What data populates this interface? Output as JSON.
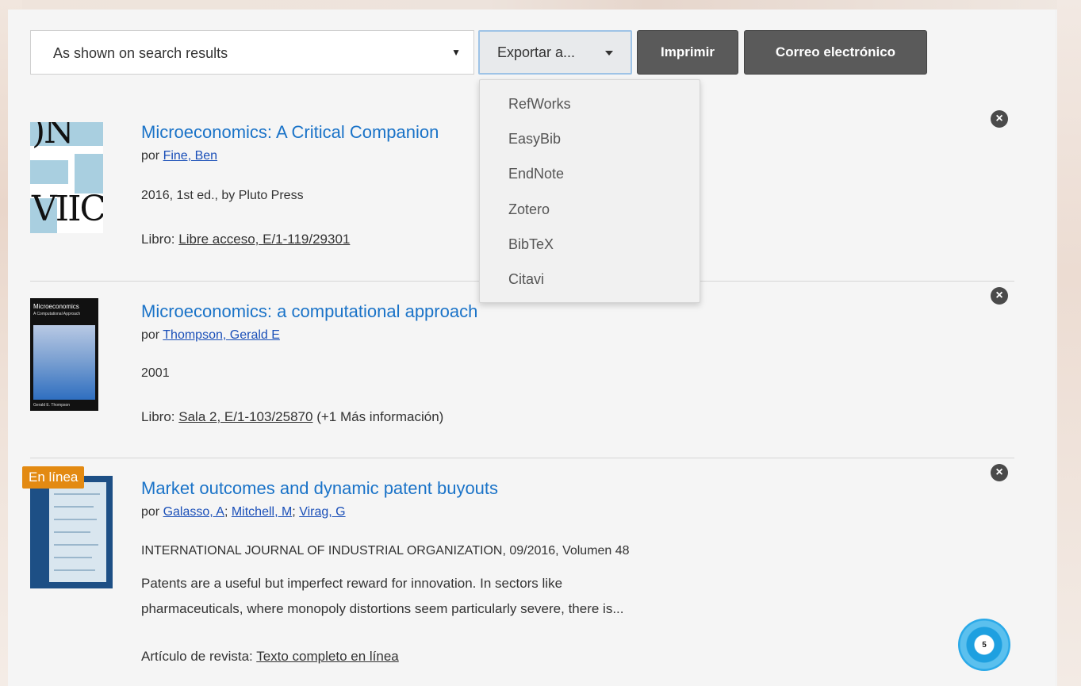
{
  "toolbar": {
    "select_value": "As shown on search results",
    "export_label": "Exportar a...",
    "print_label": "Imprimir",
    "email_label": "Correo electrónico"
  },
  "export_menu": {
    "items": [
      "RefWorks",
      "EasyBib",
      "EndNote",
      "Zotero",
      "BibTeX",
      "Citavi"
    ]
  },
  "results": [
    {
      "title": "Microeconomics: A Critical Companion",
      "por": "por",
      "authors": [
        "Fine, Ben"
      ],
      "meta": "2016, 1st ed., by Pluto Press",
      "type_label": "Libro:",
      "availability_link": "Libre acceso, E/1-119/29301",
      "availability_extra": ""
    },
    {
      "title": "Microeconomics: a computational approach",
      "por": "por",
      "authors": [
        "Thompson, Gerald E"
      ],
      "meta": "2001",
      "type_label": "Libro:",
      "availability_link": "Sala 2, E/1-103/25870",
      "availability_extra": "(+1 Más información)"
    },
    {
      "badge": "En línea",
      "title": "Market outcomes and dynamic patent buyouts",
      "por": "por",
      "authors": [
        "Galasso, A",
        "Mitchell, M",
        "Virag, G"
      ],
      "meta": "INTERNATIONAL JOURNAL OF INDUSTRIAL ORGANIZATION, 09/2016, Volumen 48",
      "abstract_line1": "Patents are a useful but imperfect reward for innovation. In sectors like",
      "abstract_line2": "pharmaceuticals, where monopoly distortions seem particularly severe, there is...",
      "type_label": "Artículo de revista:",
      "availability_link": "Texto completo en línea"
    }
  ],
  "covers": {
    "cover2_title": "Microeconomics",
    "cover2_subtitle": "A Computational Approach",
    "cover2_author": "Gerald E. Thompson"
  },
  "floating_badge": {
    "count": "5"
  },
  "colors": {
    "link_blue": "#1a73c8",
    "dark_button": "#5a5a5a",
    "badge_orange": "#e38a12"
  }
}
